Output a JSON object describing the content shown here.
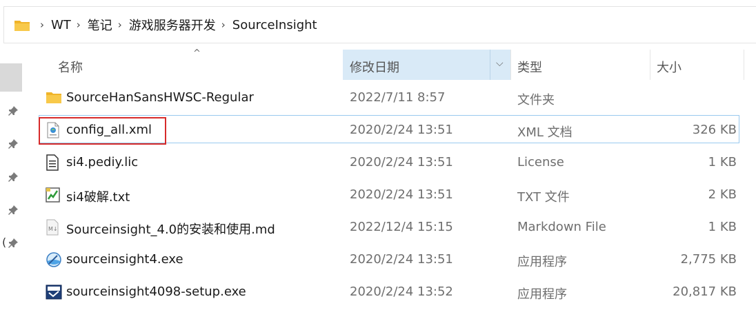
{
  "breadcrumb": {
    "items": [
      "WT",
      "笔记",
      "游戏服务器开发",
      "SourceInsight"
    ],
    "separator": "›"
  },
  "left_nav": {
    "paren": "("
  },
  "columns": {
    "name": "名称",
    "date": "修改日期",
    "type": "类型",
    "size": "大小",
    "sort_indicator": "^",
    "dropdown_glyph": "⌵"
  },
  "files": [
    {
      "name": "SourceHanSansHWSC-Regular",
      "date": "2022/7/11 8:57",
      "type": "文件夹",
      "size": "",
      "icon": "folder-icon"
    },
    {
      "name": "config_all.xml",
      "date": "2020/2/24 13:51",
      "type": "XML 文档",
      "size": "326 KB",
      "icon": "xml-file-icon"
    },
    {
      "name": "si4.pediy.lic",
      "date": "2020/2/24 13:51",
      "type": "License",
      "size": "1 KB",
      "icon": "text-file-icon"
    },
    {
      "name": "si4破解.txt",
      "date": "2020/2/24 13:51",
      "type": "TXT 文件",
      "size": "2 KB",
      "icon": "txt-file-icon"
    },
    {
      "name": "Sourceinsight_4.0的安装和使用.md",
      "date": "2022/12/4 15:15",
      "type": "Markdown File",
      "size": "1 KB",
      "icon": "markdown-file-icon"
    },
    {
      "name": "sourceinsight4.exe",
      "date": "2020/2/24 13:51",
      "type": "应用程序",
      "size": "2,775 KB",
      "icon": "sourceinsight-app-icon"
    },
    {
      "name": "sourceinsight4098-setup.exe",
      "date": "2020/2/24 13:52",
      "type": "应用程序",
      "size": "20,817 KB",
      "icon": "installer-app-icon"
    }
  ],
  "colors": {
    "selection_border": "#99c9ef",
    "sorted_column_bg": "#d9eaf7",
    "highlight_box": "#d62a2a",
    "folder_yellow": "#f8c94a"
  }
}
